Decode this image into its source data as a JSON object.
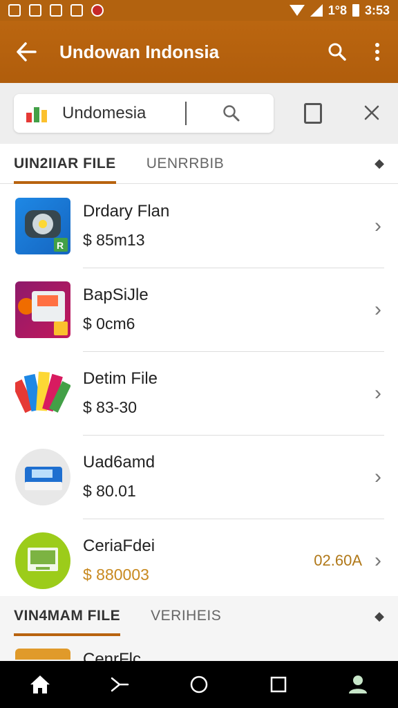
{
  "status_bar": {
    "time": "3:53",
    "network_text": "1°8"
  },
  "app_bar": {
    "title": "Undowan Indonsia"
  },
  "search": {
    "value": "Undomesia"
  },
  "tabs_primary": {
    "active": "UIN2IIAR FILE",
    "inactive": "UENRRBIB"
  },
  "items": [
    {
      "title": "Drdary Flan",
      "price": "$ 85m13",
      "side_value": ""
    },
    {
      "title": "BapSiJle",
      "price": "$ 0cm6",
      "side_value": ""
    },
    {
      "title": "Detim File",
      "price": "$ 83-30",
      "side_value": ""
    },
    {
      "title": "Uad6amd",
      "price": "$ 80.01",
      "side_value": ""
    },
    {
      "title": "CeriaFdei",
      "price": "$ 880003",
      "side_value": "02.60A"
    }
  ],
  "tabs_secondary": {
    "active": "VIN4MAM FILE",
    "inactive": "VERIHEIS"
  },
  "partial_item": {
    "title": "CenrFlc"
  },
  "colors": {
    "brand": "#b8630f",
    "accent_price": "#c8891f"
  }
}
